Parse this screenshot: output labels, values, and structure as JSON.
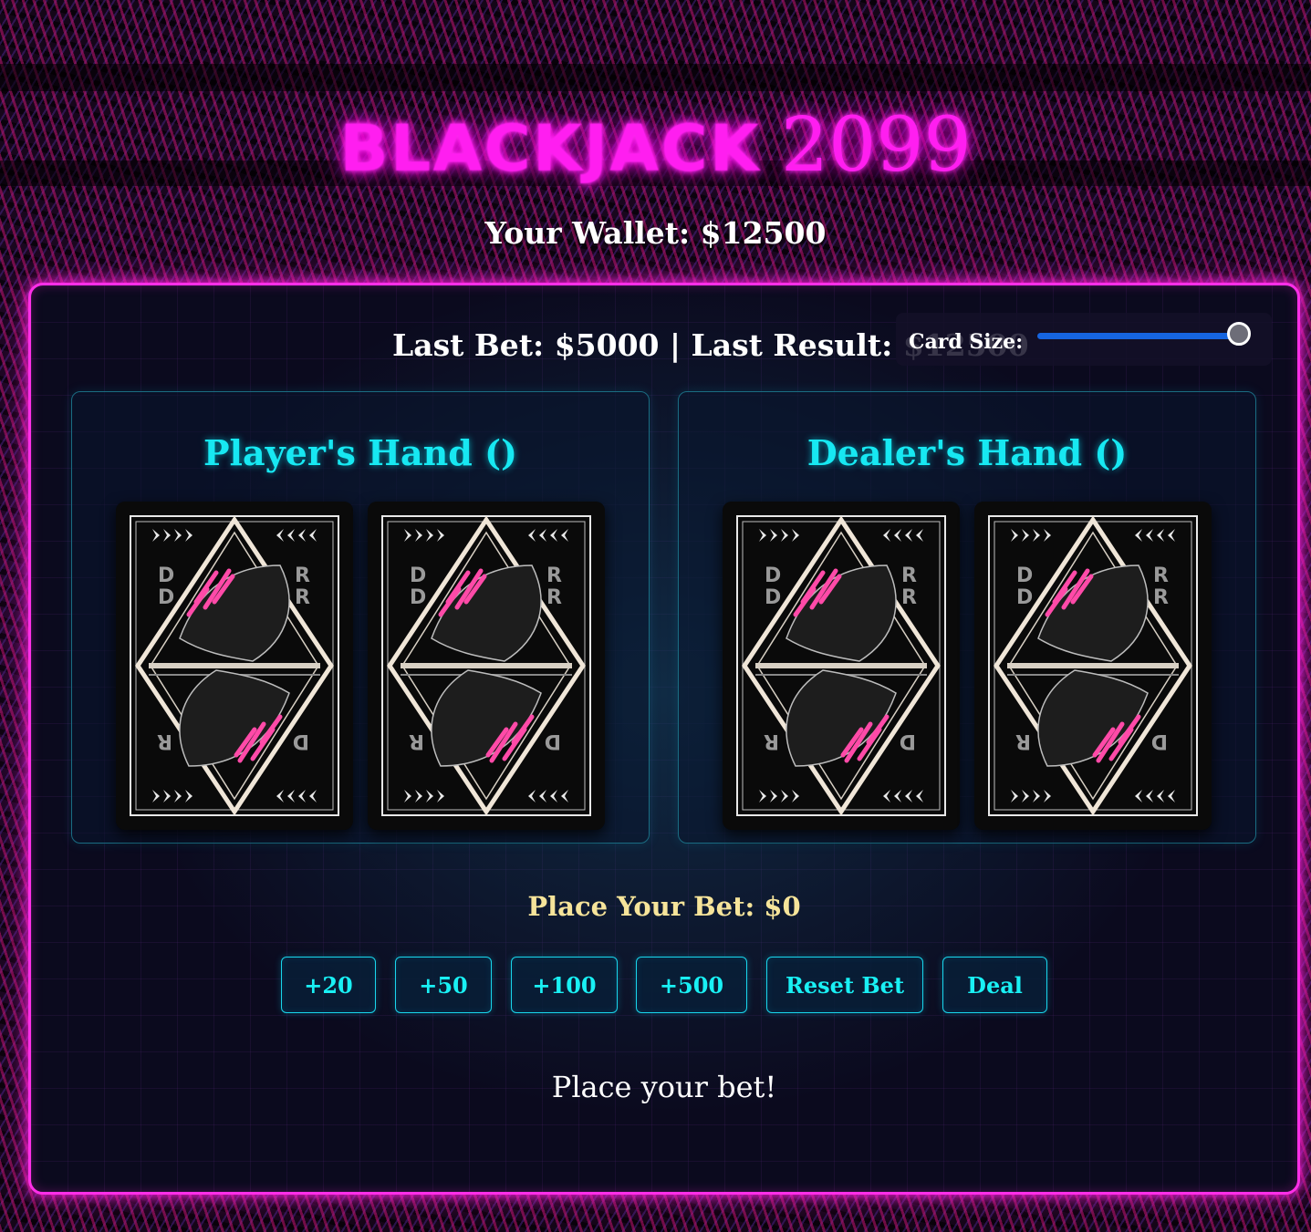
{
  "title": {
    "word1": "BLACKJACK",
    "word2": "2099"
  },
  "wallet": {
    "text": "Your Wallet: $12500"
  },
  "stats": {
    "text": "Last Bet: $5000 | Last Result: $12500"
  },
  "card_size": {
    "label": "Card Size:",
    "value_fraction": 1.0
  },
  "player": {
    "title": "Player's Hand ()",
    "cards": [
      "face-down",
      "face-down"
    ]
  },
  "dealer": {
    "title": "Dealer's Hand ()",
    "cards": [
      "face-down",
      "face-down"
    ]
  },
  "bet": {
    "label": "Place Your Bet: $0"
  },
  "buttons": {
    "add20": "+20",
    "add50": "+50",
    "add100": "+100",
    "add500": "+500",
    "reset": "Reset Bet",
    "deal": "Deal"
  },
  "status": {
    "message": "Place your bet!"
  },
  "colors": {
    "title": "#ff1ef0",
    "panel_border": "#ff2fe8",
    "hand_title": "#17e8f2",
    "bet_label": "#f6e49a",
    "button_text": "#19f0f4",
    "slider": "#1665e0"
  }
}
